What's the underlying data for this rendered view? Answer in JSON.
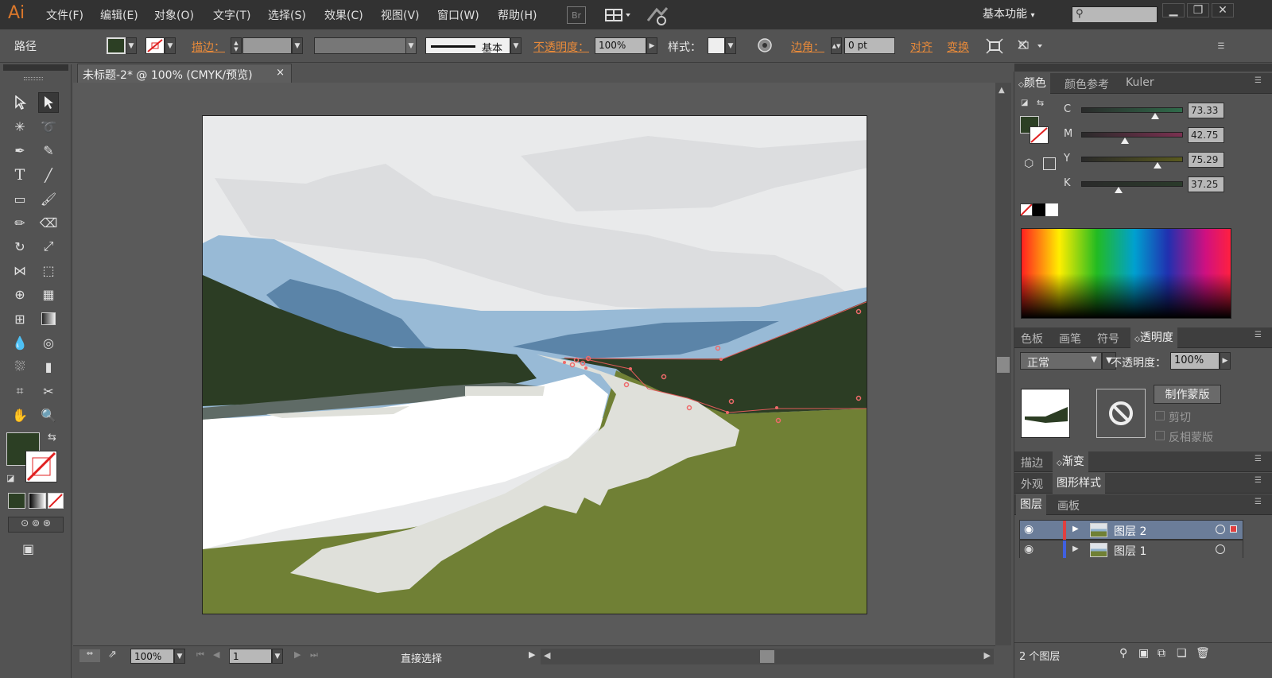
{
  "app": {
    "logo": "Ai",
    "menu": [
      "文件(F)",
      "编辑(E)",
      "对象(O)",
      "文字(T)",
      "选择(S)",
      "效果(C)",
      "视图(V)",
      "窗口(W)",
      "帮助(H)"
    ],
    "bridge_label": "Br",
    "workspace": "基本功能"
  },
  "control": {
    "object_type": "路径",
    "stroke_label": "描边：",
    "stroke_profile": "基本",
    "opacity_label": "不透明度：",
    "opacity_value": "100%",
    "style_label": "样式：",
    "corner_label": "边角：",
    "corner_value": "0 pt",
    "align_label": "对齐",
    "transform_label": "变换"
  },
  "document": {
    "tab_title": "未标题-2* @ 100% (CMYK/预览)",
    "tab_close": "×"
  },
  "status": {
    "zoom": "100%",
    "page": "1",
    "tool_name": "直接选择"
  },
  "color_panel": {
    "tabs": [
      "颜色",
      "颜色参考",
      "Kuler"
    ],
    "channels": [
      {
        "name": "C",
        "value": "73.33",
        "pct": 0.73,
        "color": "#2f6b4a"
      },
      {
        "name": "M",
        "value": "42.75",
        "pct": 0.43,
        "color": "#7a3050"
      },
      {
        "name": "Y",
        "value": "75.29",
        "pct": 0.75,
        "color": "#5a5a1e"
      },
      {
        "name": "K",
        "value": "37.25",
        "pct": 0.37,
        "color": "#2a3a2a"
      }
    ],
    "fill_color": "#2c3f24"
  },
  "transparency_panel": {
    "tabs": [
      "色板",
      "画笔",
      "符号",
      "透明度"
    ],
    "blend_mode": "正常",
    "opacity_label": "不透明度：",
    "opacity_value": "100%",
    "make_mask": "制作蒙版",
    "clip": "剪切",
    "invert": "反相蒙版"
  },
  "stroke_panel": {
    "tabs": [
      "描边",
      "渐变"
    ]
  },
  "appearance_panel": {
    "tabs": [
      "外观",
      "图形样式"
    ]
  },
  "layers_panel": {
    "tabs": [
      "图层",
      "画板"
    ],
    "layers": [
      {
        "name": "图层 2",
        "color": "#e04040"
      },
      {
        "name": "图层 1",
        "color": "#4060e0"
      }
    ],
    "count": "2 个图层"
  },
  "colors": {
    "sky": "#e9eaeb",
    "cloud": "#dcdddf",
    "mountain_light": "#98bad6",
    "mountain_mid": "#5b84a8",
    "forest": "#2c3d24",
    "snow": "#ffffff",
    "ice": "#dfe0da",
    "grass": "#708035",
    "accent": "#d9772b"
  }
}
